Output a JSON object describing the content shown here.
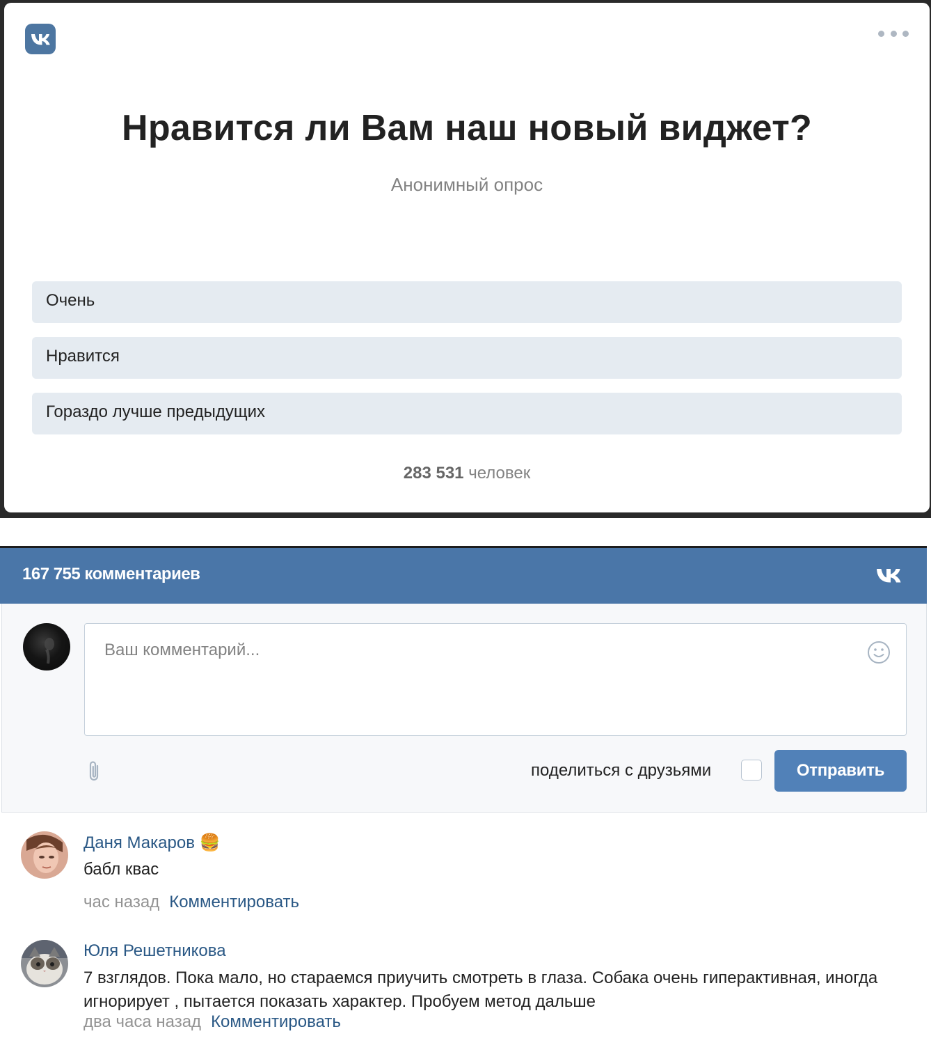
{
  "poll": {
    "title": "Нравится ли Вам наш новый виджет?",
    "subtitle": "Анонимный опрос",
    "options": [
      "Очень",
      "Нравится",
      "Гораздо лучше предыдущих"
    ],
    "total_count": "283 531",
    "total_label": "человек"
  },
  "comments": {
    "header_title": "167 755 комментариев",
    "input_placeholder": "Ваш комментарий...",
    "share_label": "поделиться с друзьями",
    "share_checked": false,
    "send_label": "Отправить",
    "items": [
      {
        "author": "Даня Макаров",
        "author_emoji": "🍔",
        "text": "бабл квас",
        "time": "час назад",
        "reply_label": "Комментировать"
      },
      {
        "author": "Юля Решетникова",
        "author_emoji": "",
        "text": "7 взглядов. Пока мало, но стараемся приучить смотреть в глаза. Собака очень гиперактивная, иногда игнорирует , пытается показать характер. Пробуем метод дальше",
        "time": "два часа назад",
        "reply_label": "Комментировать"
      }
    ]
  },
  "colors": {
    "vk_blue": "#4a76a8",
    "button_blue": "#5181b8",
    "link_blue": "#2a5885",
    "option_bg": "#e5ebf1"
  },
  "icons": [
    "vk-logo-icon",
    "more-dots-icon",
    "emoji-icon",
    "paperclip-icon",
    "burger-emoji-icon"
  ]
}
